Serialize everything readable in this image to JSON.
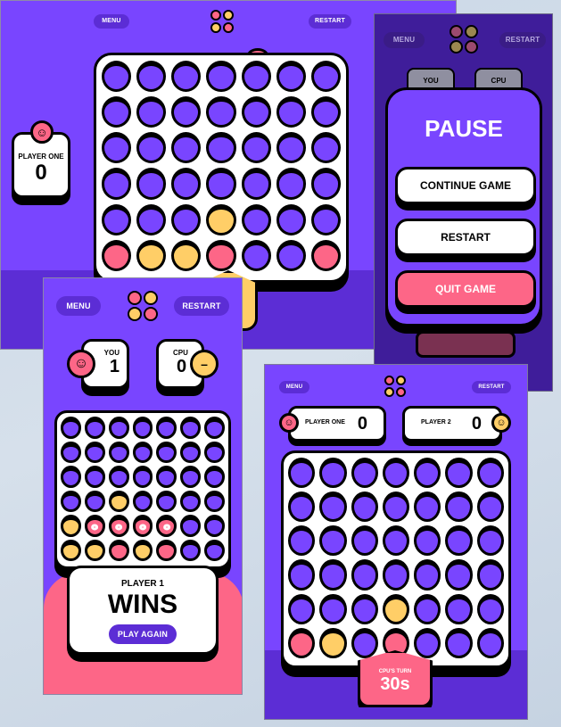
{
  "colors": {
    "purple": "#7945ff",
    "dark_purple": "#5c2dd5",
    "red": "#fd6687",
    "yellow": "#ffce67",
    "black": "#000000",
    "white": "#ffffff"
  },
  "main": {
    "menu_label": "MENU",
    "restart_label": "RESTART",
    "player_one": {
      "name": "PLAYER ONE",
      "score": "0"
    },
    "board": [
      [
        "e",
        "e",
        "e",
        "e",
        "e",
        "e",
        "e"
      ],
      [
        "e",
        "e",
        "e",
        "e",
        "e",
        "e",
        "e"
      ],
      [
        "e",
        "e",
        "e",
        "e",
        "e",
        "e",
        "e"
      ],
      [
        "e",
        "e",
        "e",
        "e",
        "e",
        "e",
        "e"
      ],
      [
        "e",
        "e",
        "e",
        "y",
        "e",
        "e",
        "e"
      ],
      [
        "r",
        "y",
        "y",
        "r",
        "e",
        "e",
        "r"
      ]
    ]
  },
  "pause": {
    "menu_label": "MENU",
    "restart_label": "RESTART",
    "you_label": "YOU",
    "cpu_label": "CPU",
    "title": "PAUSE",
    "continue_label": "CONTINUE GAME",
    "restart_button_label": "RESTART",
    "quit_label": "QUIT GAME"
  },
  "mobile": {
    "menu_label": "MENU",
    "restart_label": "RESTART",
    "you": {
      "name": "YOU",
      "score": "1"
    },
    "cpu": {
      "name": "CPU",
      "score": "0"
    },
    "board": [
      [
        "e",
        "e",
        "e",
        "e",
        "e",
        "e",
        "e"
      ],
      [
        "e",
        "e",
        "e",
        "e",
        "e",
        "e",
        "e"
      ],
      [
        "e",
        "e",
        "e",
        "e",
        "e",
        "e",
        "e"
      ],
      [
        "e",
        "e",
        "y",
        "e",
        "e",
        "e",
        "e"
      ],
      [
        "y",
        "wr",
        "wr",
        "wr",
        "wr",
        "e",
        "e"
      ],
      [
        "y",
        "y",
        "r",
        "y",
        "r",
        "e",
        "e"
      ]
    ],
    "result": {
      "player": "PLAYER 1",
      "wins": "WINS",
      "play_again": "PLAY AGAIN"
    }
  },
  "tablet": {
    "menu_label": "MENU",
    "restart_label": "RESTART",
    "player_one": {
      "name": "PLAYER ONE",
      "score": "0"
    },
    "player_two": {
      "name": "PLAYER 2",
      "score": "0"
    },
    "board": [
      [
        "e",
        "e",
        "e",
        "e",
        "e",
        "e",
        "e"
      ],
      [
        "e",
        "e",
        "e",
        "e",
        "e",
        "e",
        "e"
      ],
      [
        "e",
        "e",
        "e",
        "e",
        "e",
        "e",
        "e"
      ],
      [
        "e",
        "e",
        "e",
        "e",
        "e",
        "e",
        "e"
      ],
      [
        "e",
        "e",
        "e",
        "y",
        "e",
        "e",
        "e"
      ],
      [
        "r",
        "y",
        "e",
        "r",
        "e",
        "e",
        "e"
      ]
    ],
    "turn": {
      "label": "CPU'S TURN",
      "timer": "30s"
    }
  }
}
